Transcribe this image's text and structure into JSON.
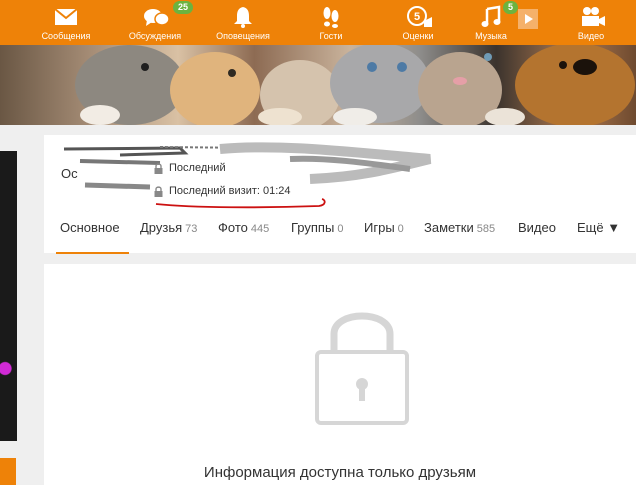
{
  "nav": [
    {
      "key": "messages",
      "label": "Сообщения",
      "icon": "envelope-icon",
      "badge": ""
    },
    {
      "key": "discussions",
      "label": "Обсуждения",
      "icon": "chat-bubbles-icon",
      "badge": "25"
    },
    {
      "key": "notifications",
      "label": "Оповещения",
      "icon": "bell-icon",
      "badge": ""
    },
    {
      "key": "guests",
      "label": "Гости",
      "icon": "footprints-icon",
      "badge": ""
    },
    {
      "key": "ratings",
      "label": "Оценки",
      "icon": "five-rating-icon",
      "badge": ""
    },
    {
      "key": "music",
      "label": "Музыка",
      "icon": "music-note-icon",
      "badge": "5"
    },
    {
      "key": "video",
      "label": "Видео",
      "icon": "video-camera-icon",
      "badge": ""
    }
  ],
  "profile": {
    "name_prefix": "Ос",
    "status1": "Последний",
    "status2": "Последний визит: 01:24"
  },
  "tabs": [
    {
      "label": "Основное",
      "count": ""
    },
    {
      "label": "Друзья",
      "count": "73"
    },
    {
      "label": "Фото",
      "count": "445"
    },
    {
      "label": "Группы",
      "count": "0"
    },
    {
      "label": "Игры",
      "count": "0"
    },
    {
      "label": "Заметки",
      "count": "585"
    },
    {
      "label": "Видео",
      "count": ""
    },
    {
      "label": "Ещё ▼",
      "count": ""
    }
  ],
  "private": {
    "message": "Информация доступна только друзьям"
  },
  "colors": {
    "brand_orange": "#ee8208",
    "badge_green": "#6cb33f",
    "annotation_red": "#cc1111"
  }
}
